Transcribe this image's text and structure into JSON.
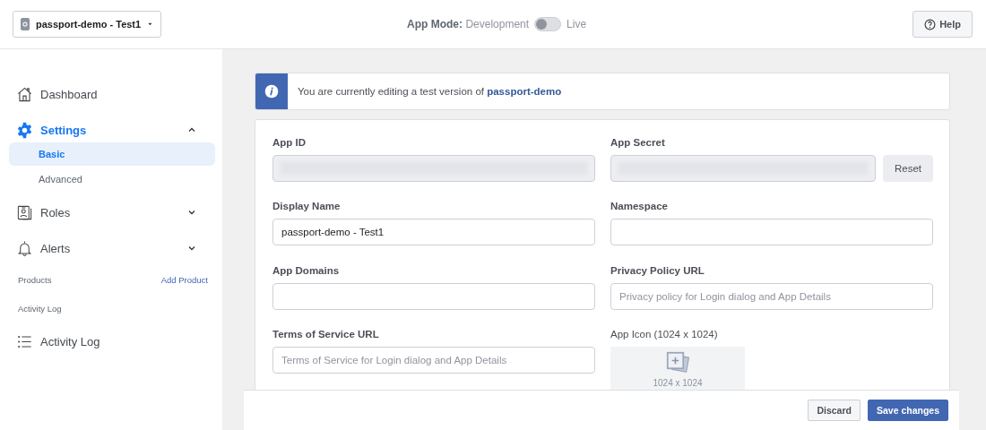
{
  "topbar": {
    "app_selector": {
      "label": "passport-demo - Test1"
    },
    "app_mode": {
      "label": "App Mode:",
      "options": [
        "Development",
        "Live"
      ],
      "live": false
    },
    "help_button": "Help"
  },
  "sidebar": {
    "items": [
      {
        "kind": "nav",
        "label": "Dashboard",
        "selected": false
      },
      {
        "kind": "nav",
        "label": "Settings",
        "selected": true,
        "expanded": true,
        "children": [
          {
            "label": "Basic",
            "selected": true
          },
          {
            "label": "Advanced",
            "selected": false
          }
        ]
      },
      {
        "kind": "nav",
        "label": "Roles",
        "selected": false,
        "expanded": false
      },
      {
        "kind": "nav",
        "label": "Alerts",
        "selected": false,
        "expanded": false
      },
      {
        "kind": "section",
        "label": "Products",
        "link": "Add Product"
      },
      {
        "kind": "section",
        "label": "Activity Log"
      },
      {
        "kind": "nav",
        "label": "Activity Log",
        "selected": false
      }
    ]
  },
  "notice": {
    "text": "You are currently editing a test version of **passport-demo**"
  },
  "form": {
    "fields": [
      {
        "kind": "masked",
        "label": "App ID"
      },
      {
        "kind": "masked",
        "label": "App Secret",
        "button": "Reset"
      },
      {
        "kind": "text",
        "label": "Display Name",
        "value": "passport-demo - Test1"
      },
      {
        "kind": "text",
        "label": "Namespace"
      },
      {
        "kind": "text",
        "label": "App Domains"
      },
      {
        "kind": "text",
        "label": "Privacy Policy URL",
        "placeholder": "Privacy policy for Login dialog and App Details"
      },
      {
        "kind": "text",
        "label": "Terms of Service URL",
        "placeholder": "Terms of Service for Login dialog and App Details"
      },
      {
        "kind": "image",
        "label": "App Icon (1024 x 1024)",
        "hint": "1024 x 1024"
      }
    ]
  },
  "footer": {
    "buttons": [
      {
        "label": "Discard",
        "primary": false
      },
      {
        "label": "Save changes",
        "primary": true
      }
    ]
  }
}
